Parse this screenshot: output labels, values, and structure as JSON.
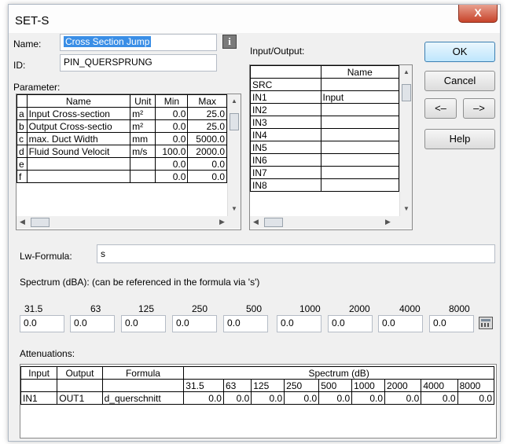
{
  "window": {
    "title": "SET-S",
    "close_label": "X"
  },
  "name": {
    "label": "Name:",
    "value": "Cross Section Jump"
  },
  "id": {
    "label": "ID:",
    "value": "PIN_QUERSPRUNG"
  },
  "io": {
    "label": "Input/Output:",
    "header": "Name",
    "rows": [
      {
        "id": "SRC",
        "name": ""
      },
      {
        "id": "IN1",
        "name": "Input"
      },
      {
        "id": "IN2",
        "name": ""
      },
      {
        "id": "IN3",
        "name": ""
      },
      {
        "id": "IN4",
        "name": ""
      },
      {
        "id": "IN5",
        "name": ""
      },
      {
        "id": "IN6",
        "name": ""
      },
      {
        "id": "IN7",
        "name": ""
      },
      {
        "id": "IN8",
        "name": ""
      }
    ]
  },
  "buttons": {
    "ok": "OK",
    "cancel": "Cancel",
    "left": "<–",
    "right": "–>",
    "help": "Help"
  },
  "parameter": {
    "label": "Parameter:",
    "headers": [
      "Name",
      "Unit",
      "Min",
      "Max"
    ],
    "rows": [
      {
        "key": "a",
        "name": "Input Cross-section",
        "unit": "m²",
        "min": "0.0",
        "max": "25.0"
      },
      {
        "key": "b",
        "name": "Output Cross-sectio",
        "unit": "m²",
        "min": "0.0",
        "max": "25.0"
      },
      {
        "key": "c",
        "name": "max. Duct Width",
        "unit": "mm",
        "min": "0.0",
        "max": "5000.0"
      },
      {
        "key": "d",
        "name": "Fluid Sound Velocit",
        "unit": "m/s",
        "min": "100.0",
        "max": "2000.0"
      },
      {
        "key": "e",
        "name": "",
        "unit": "",
        "min": "0.0",
        "max": "0.0"
      },
      {
        "key": "f",
        "name": "",
        "unit": "",
        "min": "0.0",
        "max": "0.0"
      }
    ]
  },
  "formula": {
    "label": "Lw-Formula:",
    "value": "s"
  },
  "spectrum": {
    "label": "Spectrum (dBA): (can be referenced in the formula via 's')",
    "bands": [
      "31.5",
      "63",
      "125",
      "250",
      "500",
      "1000",
      "2000",
      "4000",
      "8000"
    ],
    "values": [
      "0.0",
      "0.0",
      "0.0",
      "0.0",
      "0.0",
      "0.0",
      "0.0",
      "0.0",
      "0.0"
    ]
  },
  "attenuations": {
    "label": "Attenuations:",
    "headers": {
      "input": "Input",
      "output": "Output",
      "formula": "Formula",
      "spectrum": "Spectrum (dB)"
    },
    "bands": [
      "31.5",
      "63",
      "125",
      "250",
      "500",
      "1000",
      "2000",
      "4000",
      "8000"
    ],
    "rows": [
      {
        "input": "IN1",
        "output": "OUT1",
        "formula": "d_querschnitt",
        "values": [
          "0.0",
          "0.0",
          "0.0",
          "0.0",
          "0.0",
          "0.0",
          "0.0",
          "0.0",
          "0.0"
        ]
      }
    ]
  },
  "icons": {
    "info": "info-icon",
    "calc": "calculator-icon"
  }
}
